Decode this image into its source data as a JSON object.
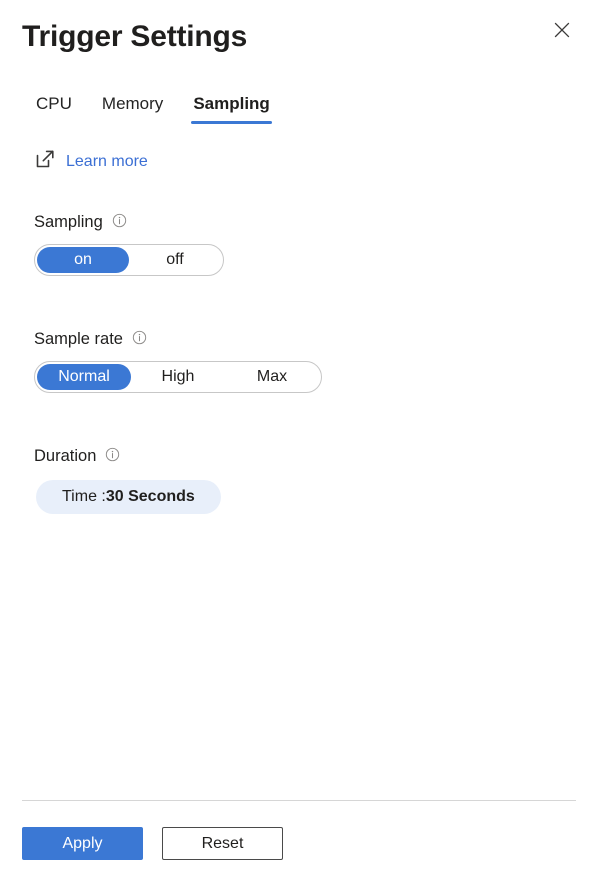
{
  "header": {
    "title": "Trigger Settings",
    "close_icon": "close-icon"
  },
  "tabs": [
    {
      "label": "CPU",
      "active": false
    },
    {
      "label": "Memory",
      "active": false
    },
    {
      "label": "Sampling",
      "active": true
    }
  ],
  "learn_more": {
    "label": "Learn more",
    "icon": "external-link-icon"
  },
  "fields": {
    "sampling": {
      "label": "Sampling",
      "info_icon": "info-icon",
      "options": [
        {
          "label": "on",
          "selected": true
        },
        {
          "label": "off",
          "selected": false
        }
      ]
    },
    "sample_rate": {
      "label": "Sample rate",
      "info_icon": "info-icon",
      "options": [
        {
          "label": "Normal",
          "selected": true
        },
        {
          "label": "High",
          "selected": false
        },
        {
          "label": "Max",
          "selected": false
        }
      ]
    },
    "duration": {
      "label": "Duration",
      "info_icon": "info-icon",
      "chip_label": "Time : ",
      "chip_value": "30 Seconds"
    }
  },
  "footer": {
    "apply_label": "Apply",
    "reset_label": "Reset"
  },
  "colors": {
    "accent": "#3b78d4",
    "link": "#3b6fd4",
    "chip_bg": "#e8effa",
    "text": "#201f1e",
    "border": "#c7c7c7",
    "divider": "#d6d6d6"
  }
}
